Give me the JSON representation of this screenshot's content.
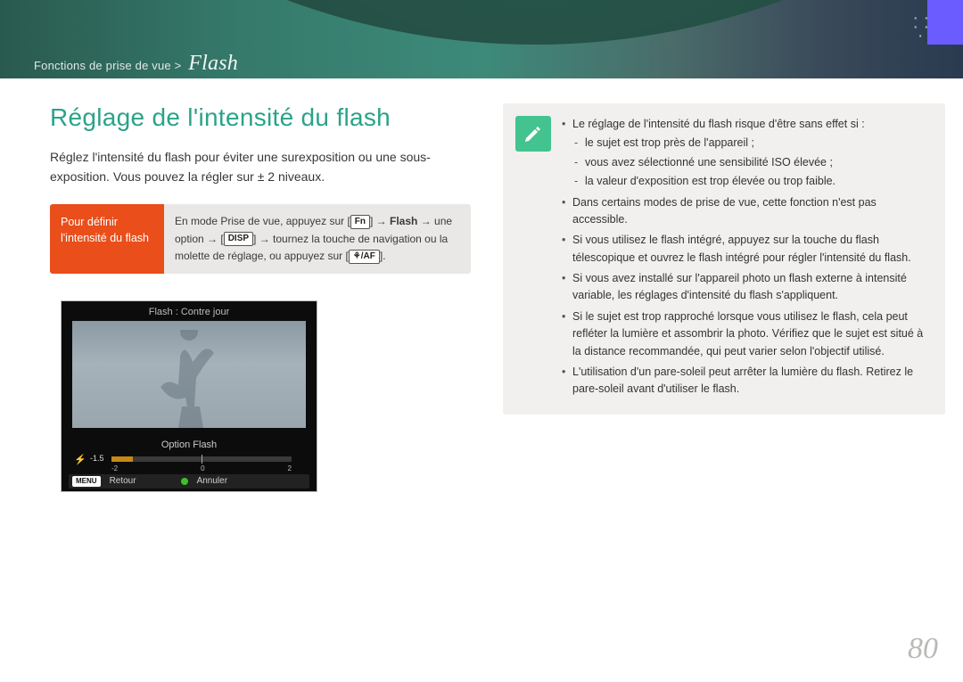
{
  "header": {
    "breadcrumb_prefix": "Fonctions de prise de vue >",
    "breadcrumb_section": "Flash"
  },
  "page_number": "80",
  "main": {
    "title": "Réglage de l'intensité du flash",
    "intro": "Réglez l'intensité du flash pour éviter une surexposition ou une sous-exposition. Vous pouvez la régler sur ± 2 niveaux.",
    "instruction": {
      "label": "Pour définir l'intensité du flash",
      "body_pre": "En mode Prise de vue, appuyez sur [",
      "key_fn": "Fn",
      "body_mid1": "] → ",
      "bold_flash": "Flash",
      "body_mid2": " → une option → [",
      "key_disp": "DISP",
      "body_mid3": "] → tournez la touche de navigation ou la molette de réglage, ou appuyez sur [",
      "key_af": "⚘/AF",
      "body_end": "]."
    }
  },
  "lcd": {
    "title": "Flash : Contre jour",
    "option": "Option Flash",
    "value": "-1.5",
    "ticks": {
      "left": "-2",
      "mid": "0",
      "right": "2"
    },
    "footer_menu": "MENU",
    "footer_back": "Retour",
    "footer_cancel": "Annuler"
  },
  "notes": {
    "items": [
      {
        "text": "Le réglage de l'intensité du flash risque d'être sans effet si :",
        "sub": [
          "le sujet est trop près de l'appareil ;",
          "vous avez sélectionné une sensibilité ISO élevée ;",
          "la valeur d'exposition est trop élevée ou trop faible."
        ]
      },
      {
        "text": "Dans certains modes de prise de vue, cette fonction n'est pas accessible."
      },
      {
        "text": "Si vous utilisez le flash intégré, appuyez sur la touche du flash télescopique et ouvrez le flash intégré pour régler l'intensité du flash."
      },
      {
        "text": "Si vous avez installé sur l'appareil photo un flash externe à intensité variable, les réglages d'intensité du flash s'appliquent."
      },
      {
        "text": "Si le sujet est trop rapproché lorsque vous utilisez le flash, cela peut refléter la lumière et assombrir la photo. Vérifiez que le sujet est situé à la distance recommandée, qui peut varier selon l'objectif utilisé."
      },
      {
        "text": "L'utilisation d'un pare-soleil peut arrêter la lumière du flash. Retirez le pare-soleil avant d'utiliser le flash."
      }
    ]
  }
}
